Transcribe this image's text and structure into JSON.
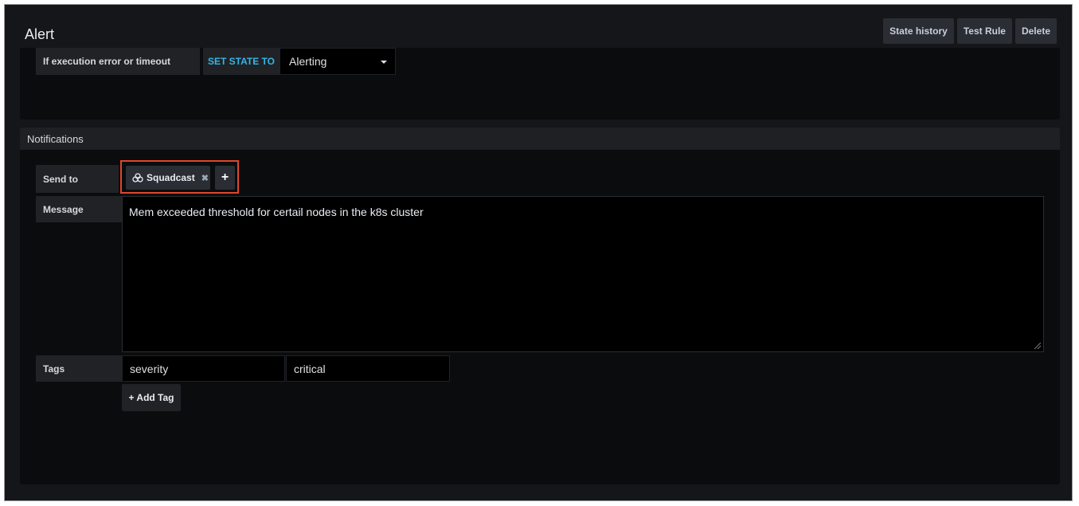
{
  "header": {
    "title": "Alert",
    "buttons": [
      "State history",
      "Test Rule",
      "Delete"
    ]
  },
  "execution": {
    "label": "If execution error or timeout",
    "set_state_label": "SET STATE TO",
    "state_value": "Alerting"
  },
  "notifications": {
    "title": "Notifications",
    "send_to_label": "Send to",
    "recipient": "Squadcast",
    "recipient_icon": "squadcast-logo-icon",
    "remove_icon": "✖",
    "add_icon": "+",
    "message_label": "Message",
    "message_value": "Mem exceeded threshold for certail nodes in the k8s cluster",
    "tags_label": "Tags",
    "tag_key": "severity",
    "tag_value": "critical",
    "add_tag_label": "+ Add Tag"
  },
  "colors": {
    "accent_blue": "#33b5e5",
    "highlight_red": "#e0452a"
  }
}
